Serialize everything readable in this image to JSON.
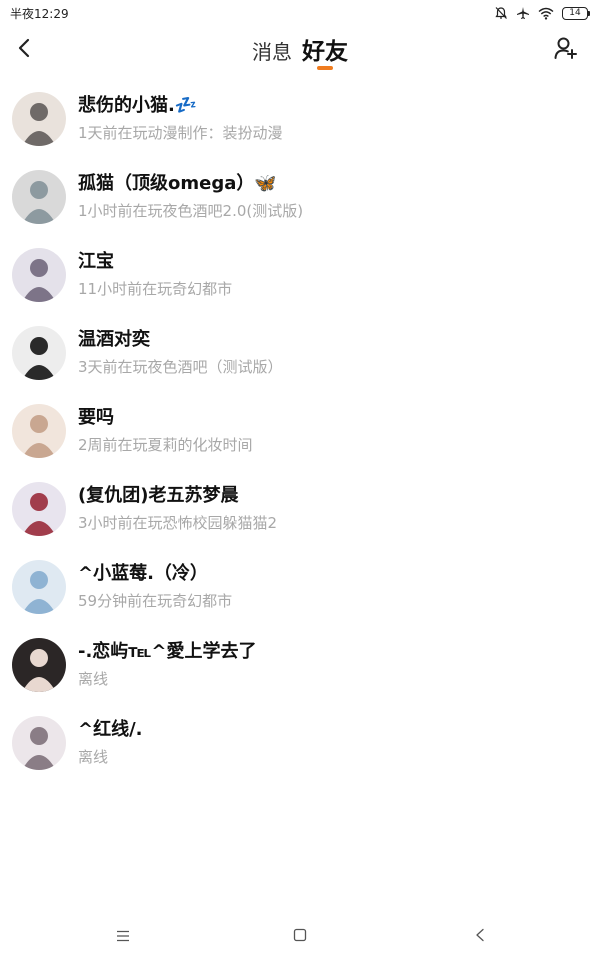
{
  "status_bar": {
    "time": "半夜12:29",
    "battery_level": "14",
    "icons": [
      "bell-off-icon",
      "airplane-icon",
      "wifi-icon",
      "battery-icon"
    ]
  },
  "header": {
    "back_icon": "chevron-left-icon",
    "tabs": [
      {
        "label": "消息",
        "active": false
      },
      {
        "label": "好友",
        "active": true
      }
    ],
    "add_friend_icon": "add-user-icon",
    "accent_color": "#f07c1f"
  },
  "friends": [
    {
      "name": "悲伤的小猫.💤",
      "status": "1天前在玩动漫制作：装扮动漫",
      "avatar_bg": "#e9e2dc",
      "avatar_fg": "#6f6a68"
    },
    {
      "name": "孤猫（顶级omega）🦋",
      "status": "1小时前在玩夜色酒吧2.0(测试版)",
      "avatar_bg": "#d9d9d9",
      "avatar_fg": "#8d9aa0"
    },
    {
      "name": "江宝",
      "status": "11小时前在玩奇幻都市",
      "avatar_bg": "#e4e1ea",
      "avatar_fg": "#7d7488"
    },
    {
      "name": "温酒对奕",
      "status": "3天前在玩夜色酒吧（测试版）",
      "avatar_bg": "#ededed",
      "avatar_fg": "#2a2a2a"
    },
    {
      "name": "要吗",
      "status": "2周前在玩夏莉的化妆时间",
      "avatar_bg": "#f1e5dc",
      "avatar_fg": "#c9a791"
    },
    {
      "name": "(复仇团)老五苏梦晨",
      "status": "3小时前在玩恐怖校园躲猫猫2",
      "avatar_bg": "#e8e4ee",
      "avatar_fg": "#a13d4c"
    },
    {
      "name": "^小蓝莓.（冷）",
      "status": "59分钟前在玩奇幻都市",
      "avatar_bg": "#dfe9f2",
      "avatar_fg": "#8fb3d3"
    },
    {
      "name": "-.恋屿℡^愛上学去了",
      "status": "离线",
      "avatar_bg": "#2b2626",
      "avatar_fg": "#e8d8d0"
    },
    {
      "name": "^红线/.",
      "status": "离线",
      "avatar_bg": "#ece6ea",
      "avatar_fg": "#8a7d86"
    }
  ],
  "nav_bar": {
    "icons": [
      "menu-icon",
      "home-square-icon",
      "back-triangle-icon"
    ]
  }
}
